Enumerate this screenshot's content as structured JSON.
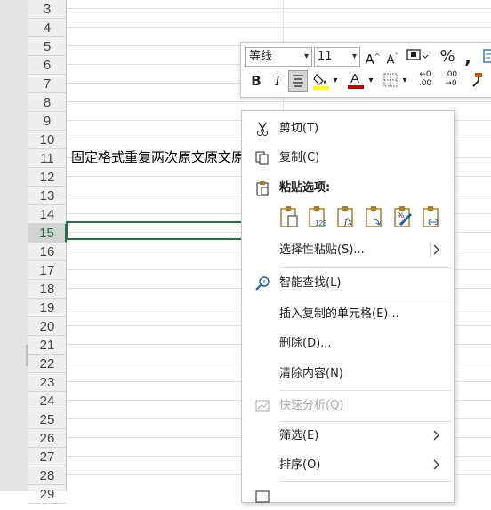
{
  "rows": [
    "3",
    "4",
    "5",
    "6",
    "7",
    "8",
    "9",
    "10",
    "11",
    "12",
    "13",
    "14",
    "15",
    "16",
    "17",
    "18",
    "19",
    "20",
    "21",
    "22",
    "23",
    "24",
    "25",
    "26",
    "27",
    "28",
    "29"
  ],
  "selected_row": "15",
  "cell_text": "固定格式重复两次原文原文原文",
  "mini_toolbar": {
    "font_name": "等线",
    "font_size": "11",
    "icons": [
      "increase-font-size",
      "decrease-font-size",
      "accounting-format",
      "percent-style",
      "comma-style",
      "wrap-text",
      "bold",
      "italic",
      "align-center",
      "fill-color",
      "font-color",
      "borders",
      "increase-decimal",
      "decrease-decimal",
      "format-painter"
    ],
    "fill_color": "#ffff00",
    "font_color": "#c00000"
  },
  "menu": {
    "cut": "剪切(T)",
    "copy": "复制(C)",
    "paste_options_header": "粘贴选项:",
    "paste_options": [
      "paste",
      "paste-values",
      "paste-formulas",
      "paste-transpose",
      "paste-formatting",
      "paste-link"
    ],
    "paste_special": "选择性粘贴(S)...",
    "smart_lookup": "智能查找(L)",
    "insert_copied_cells": "插入复制的单元格(E)...",
    "delete": "删除(D)...",
    "clear_contents": "清除内容(N)",
    "quick_analysis": "快速分析(Q)",
    "filter": "筛选(E)",
    "sort": "排序(O)"
  },
  "colors": {
    "accent": "#217346"
  }
}
